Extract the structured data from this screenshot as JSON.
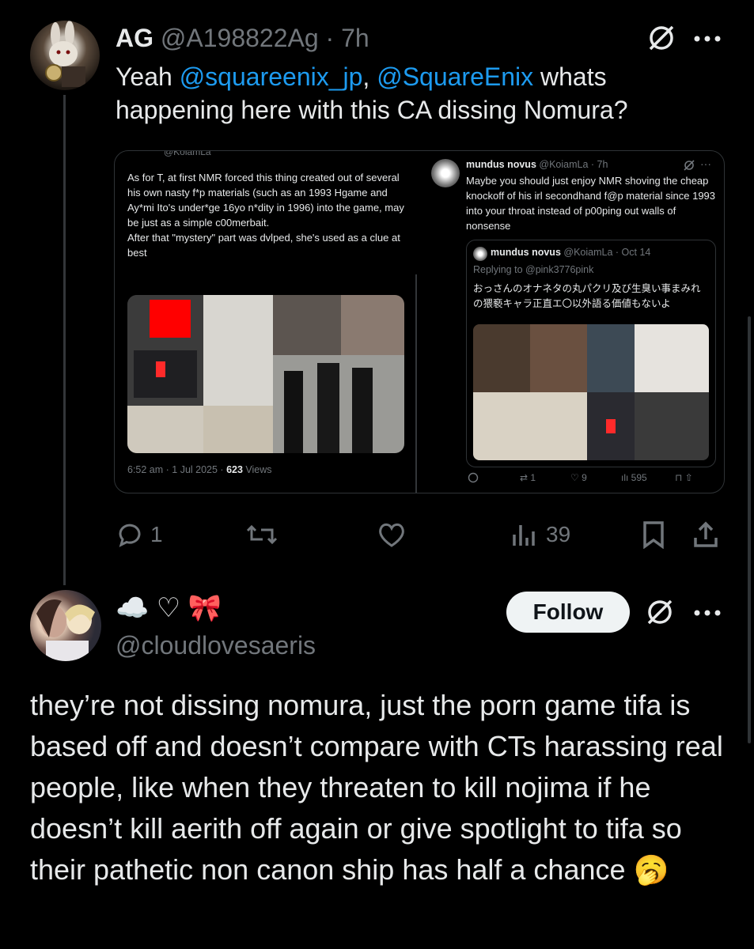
{
  "tweet1": {
    "name": "AG",
    "handle": "@A198822Ag",
    "dot": "·",
    "time": "7h",
    "text_prefix": "Yeah ",
    "mention1": "@squareenix_jp",
    "comma": ",",
    "mention2": "@SquareEnix",
    "text_rest": " whats happening here with this CA dissing Nomura?",
    "actions": {
      "replies": "1",
      "views": "39"
    }
  },
  "embed_left": {
    "cut_handle": "@KoiamLa",
    "text": "As for T, at first NMR forced this thing created out of several his own nasty f*p materials (such as an 1993 Hgame and Ay*mi Ito's under*ge 16yo n*dity in 1996) into the game, may be just as a simple c00merbait.\nAfter that \"mystery\" part was dvlped, she's used as a clue at best",
    "meta_time": "6:52 am · 1 Jul 2025 · ",
    "meta_views_num": "623",
    "meta_views_label": " Views"
  },
  "embed_right": {
    "name": "mundus novus",
    "handle": "@KoiamLa · 7h",
    "text": "Maybe you should just enjoy NMR shoving the cheap knockoff of his irl secondhand f@p material since 1993 into your throat instead of p00ping out walls of nonsense",
    "nested": {
      "name": "mundus novus",
      "handle": "@KoiamLa · Oct 14",
      "replying": "Replying to @pink3776pink",
      "text": "おっさんのオナネタの丸パクリ及び生臭い事まみれの猥褻キャラ正直エ〇以外語る価値もないよ"
    },
    "actions": {
      "retweets": "1",
      "likes": "9",
      "views": "595"
    }
  },
  "tweet2": {
    "name_emoji_1": "☁️",
    "name_emoji_2": "♡",
    "name_emoji_3": "🎀",
    "handle": "@cloudlovesaeris",
    "follow_label": "Follow",
    "text": "they’re not dissing nomura, just the porn game tifa is based off and doesn’t compare with CTs harassing real people, like when they threaten to kill nojima if he doesn’t kill aerith off again or give spotlight to tifa so their pathetic non canon ship has half a chance 🥱"
  },
  "icons": [
    "verified-slash-icon",
    "more-icon",
    "reply-icon",
    "retweet-icon",
    "like-icon",
    "views-icon",
    "bookmark-icon",
    "share-icon"
  ],
  "colors": {
    "link": "#1d9bf0",
    "muted": "#71767b",
    "text": "#e7e9ea",
    "border": "#2f3336"
  }
}
